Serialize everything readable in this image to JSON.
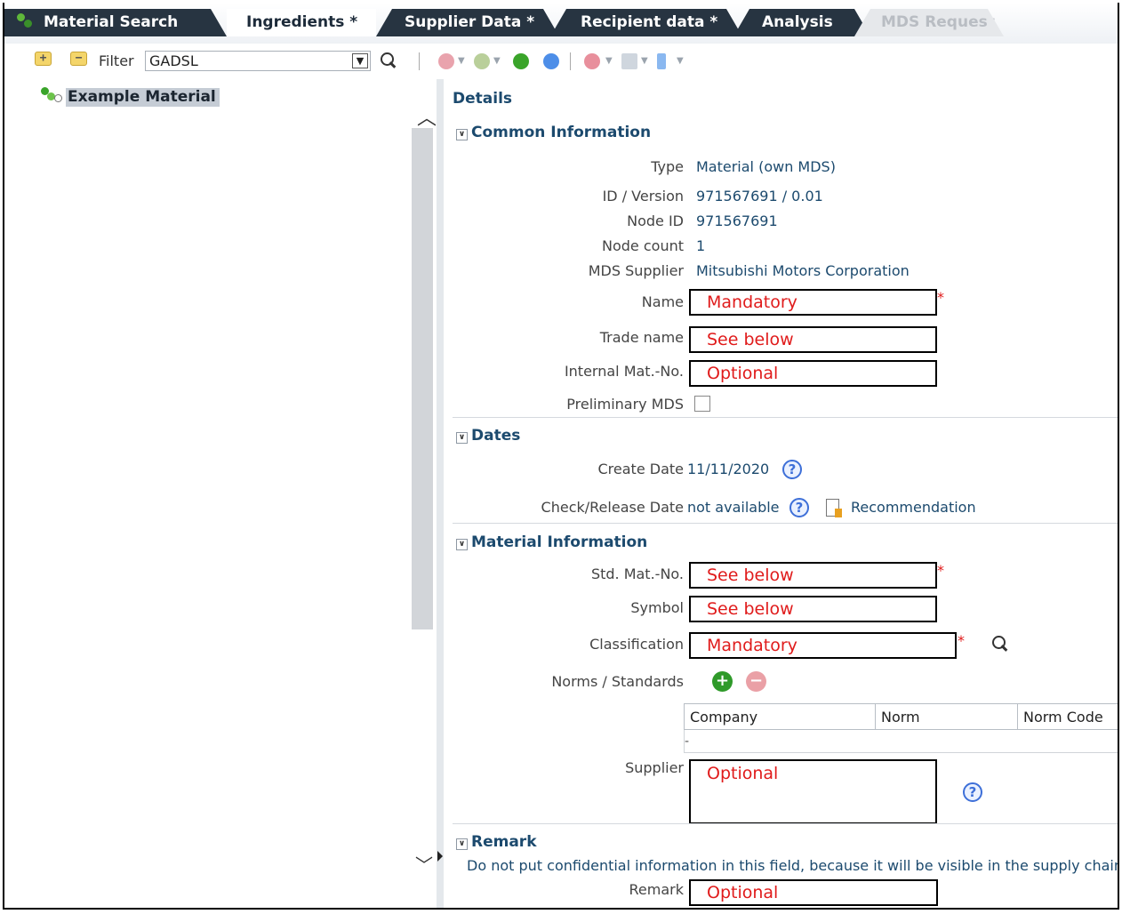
{
  "tabs": [
    {
      "label": "Material Search",
      "state": "inactive"
    },
    {
      "label": "Ingredients *",
      "state": "active"
    },
    {
      "label": "Supplier Data *",
      "state": "inactive"
    },
    {
      "label": "Recipient data *",
      "state": "inactive"
    },
    {
      "label": "Analysis",
      "state": "inactive"
    },
    {
      "label": "MDS Request",
      "state": "disabled"
    }
  ],
  "toolbar": {
    "filter_label": "Filter",
    "filter_value": "GADSL"
  },
  "tree": {
    "node_label": "Example Material"
  },
  "details": {
    "title": "Details",
    "common": {
      "header": "Common Information",
      "type_label": "Type",
      "type_value": "Material (own MDS)",
      "idversion_label": "ID / Version",
      "idversion_value": "971567691 / 0.01",
      "nodeid_label": "Node ID",
      "nodeid_value": "971567691",
      "nodecount_label": "Node count",
      "nodecount_value": "1",
      "supplier_label": "MDS Supplier",
      "supplier_value": "Mitsubishi Motors Corporation",
      "name_label": "Name",
      "name_value": "Mandatory",
      "tradename_label": "Trade name",
      "tradename_value": "See below",
      "internal_label": "Internal Mat.-No.",
      "internal_value": "Optional",
      "prelim_label": "Preliminary MDS"
    },
    "dates": {
      "header": "Dates",
      "create_label": "Create Date",
      "create_value": "11/11/2020",
      "check_label": "Check/Release Date",
      "check_value": "not available",
      "recommendation": "Recommendation"
    },
    "material": {
      "header": "Material Information",
      "stdmat_label": "Std. Mat.-No.",
      "stdmat_value": "See below",
      "symbol_label": "Symbol",
      "symbol_value": "See below",
      "class_label": "Classification",
      "class_value": "Mandatory",
      "norms_label": "Norms / Standards",
      "norms_columns": [
        "Company",
        "Norm",
        "Norm Code"
      ],
      "norms_empty": "-",
      "supplier_label": "Supplier",
      "supplier_value": "Optional"
    },
    "remark": {
      "header": "Remark",
      "note": "Do not put confidential information in this field, because it will be visible in the supply chain.",
      "label": "Remark",
      "value": "Optional"
    }
  },
  "colors": {
    "tab_dark": "#273441",
    "accent_text": "#1c4a6e",
    "annotation_red": "#e01b1b"
  }
}
